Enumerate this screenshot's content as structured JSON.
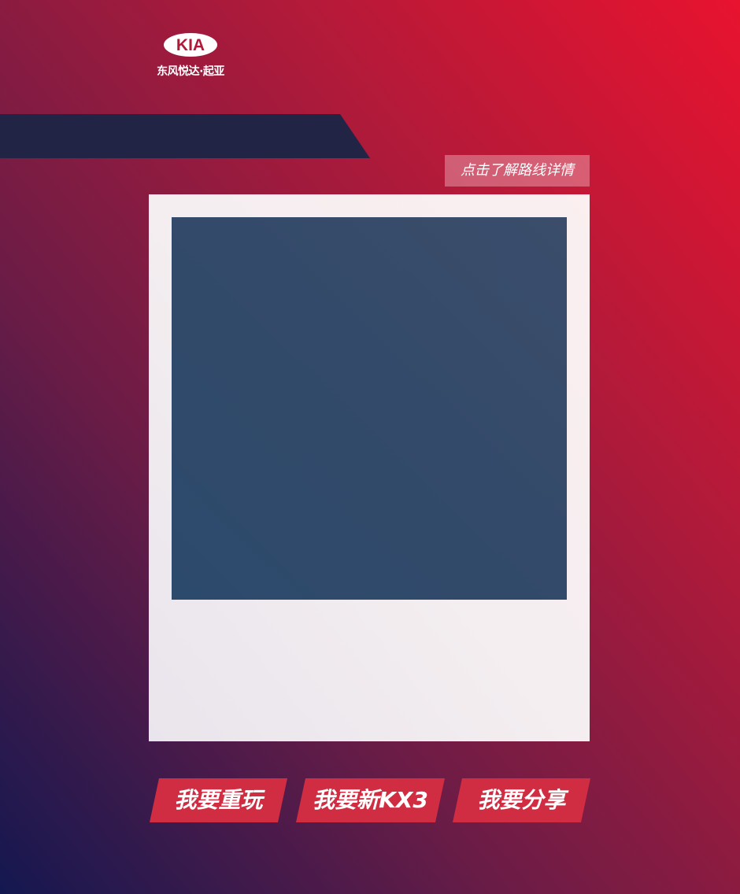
{
  "brand": {
    "logo_text": "KIA",
    "subtitle": "东风悦达·起亚"
  },
  "route_button_label": "点击了解路线详情",
  "actions": {
    "replay_label": "我要重玩",
    "new_kx3_label": "我要新KX3",
    "share_label": "我要分享"
  },
  "colors": {
    "button_red": "#d12d42",
    "navy_band": "#222446",
    "photo_placeholder": "#334a6a"
  }
}
